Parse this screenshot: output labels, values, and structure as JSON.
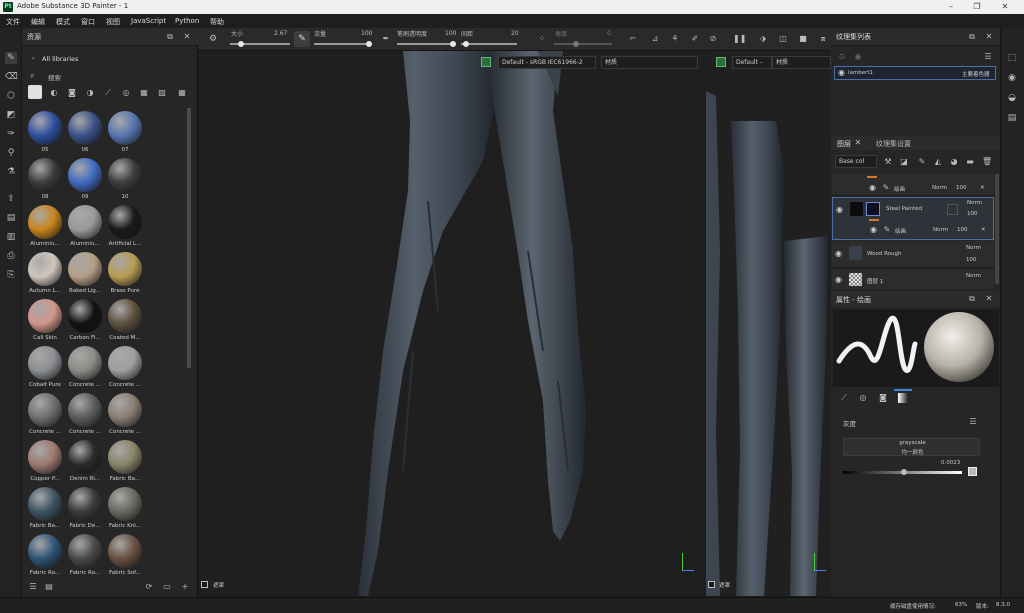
{
  "window": {
    "title": "Adobe Substance 3D Painter - 1",
    "logo": "Pt"
  },
  "menu": [
    "文件",
    "编辑",
    "模式",
    "窗口",
    "视图",
    "JavaScript",
    "Python",
    "帮助"
  ],
  "assets": {
    "title": "资源",
    "library": "All libraries",
    "search_placeholder": "搜索",
    "items": [
      {
        "label": "05",
        "color": "#2f4fa0"
      },
      {
        "label": "06",
        "color": "#3c5288"
      },
      {
        "label": "07",
        "color": "#5676b0"
      },
      {
        "label": "08",
        "color": "#3a3d3b"
      },
      {
        "label": "09",
        "color": "#3f6bc0"
      },
      {
        "label": "10",
        "color": "#3d3e3c"
      },
      {
        "label": "Aluminiu...",
        "color": "#c9851d"
      },
      {
        "label": "Aluminiu...",
        "color": "#9a9a9a"
      },
      {
        "label": "Artificial L...",
        "color": "#1a1a1a"
      },
      {
        "label": "Autumn L...",
        "color": "#d0c6bc"
      },
      {
        "label": "Baked Lig...",
        "color": "#b59f86"
      },
      {
        "label": "Brass Pure",
        "color": "#b79b53"
      },
      {
        "label": "Call Skin",
        "color": "#d2958a"
      },
      {
        "label": "Carbon Fi...",
        "color": "#121212"
      },
      {
        "label": "Coated M...",
        "color": "#5e5240"
      },
      {
        "label": "Cobalt Pure",
        "color": "#8c8f92"
      },
      {
        "label": "Concrete ...",
        "color": "#8c8a85"
      },
      {
        "label": "Concrete ...",
        "color": "#9e9e9c"
      },
      {
        "label": "Concrete ...",
        "color": "#6f6f6d"
      },
      {
        "label": "Concrete ...",
        "color": "#5d5d5b"
      },
      {
        "label": "Concrete ...",
        "color": "#8a7e73"
      },
      {
        "label": "Copper P...",
        "color": "#9d7a72"
      },
      {
        "label": "Denim Ri...",
        "color": "#2a2a2a"
      },
      {
        "label": "Fabric Ba...",
        "color": "#8a8469"
      },
      {
        "label": "Fabric Ba...",
        "color": "#3e5563"
      },
      {
        "label": "Fabric De...",
        "color": "#3b3b3b"
      },
      {
        "label": "Fabric Kni...",
        "color": "#6a6a62"
      },
      {
        "label": "Fabric Ro...",
        "color": "#2f5576"
      },
      {
        "label": "Fabric Ro...",
        "color": "#4a4a48"
      },
      {
        "label": "Fabric Sof...",
        "color": "#6a5143"
      }
    ]
  },
  "toolbar": {
    "size_label": "大小",
    "size_value": "2.67",
    "flow_label": "流量",
    "flow_value": "100",
    "opacity_label": "笔刷透明度",
    "opacity_value": "100",
    "spacing_label": "间距",
    "spacing_value": "20",
    "angle_label": "角度",
    "angle_value": "0"
  },
  "viewport": {
    "colorspace": "Default - sRGB IEC61966-2",
    "material": "材质",
    "colorspace2": "Default -",
    "material2": "材质",
    "mask_label": "遮罩",
    "mask_label2": "遮罩"
  },
  "texture_sets": {
    "title": "纹理集列表",
    "item": "lambert1",
    "shader": "主要着色器"
  },
  "layers": {
    "tab1": "图层",
    "tab2": "纹理集设置",
    "channel": "Base col",
    "fill_label": "绘画",
    "blend": "Norm",
    "opacity": "100",
    "items": [
      {
        "name": "Steel Painted"
      },
      {
        "name": "Wood Rough"
      },
      {
        "name": "图层 1"
      }
    ],
    "sub1": "绘画",
    "sub2": "绘画"
  },
  "properties": {
    "title": "属性 - 绘画",
    "section": "灰度",
    "mode": "grayscale",
    "mode_desc": "均一颜色",
    "value": "0.0023"
  },
  "status": {
    "cache_label": "缓存磁盘使用情况:",
    "cache_value": "63%",
    "version_label": "版本:",
    "version": "8.3.0"
  }
}
